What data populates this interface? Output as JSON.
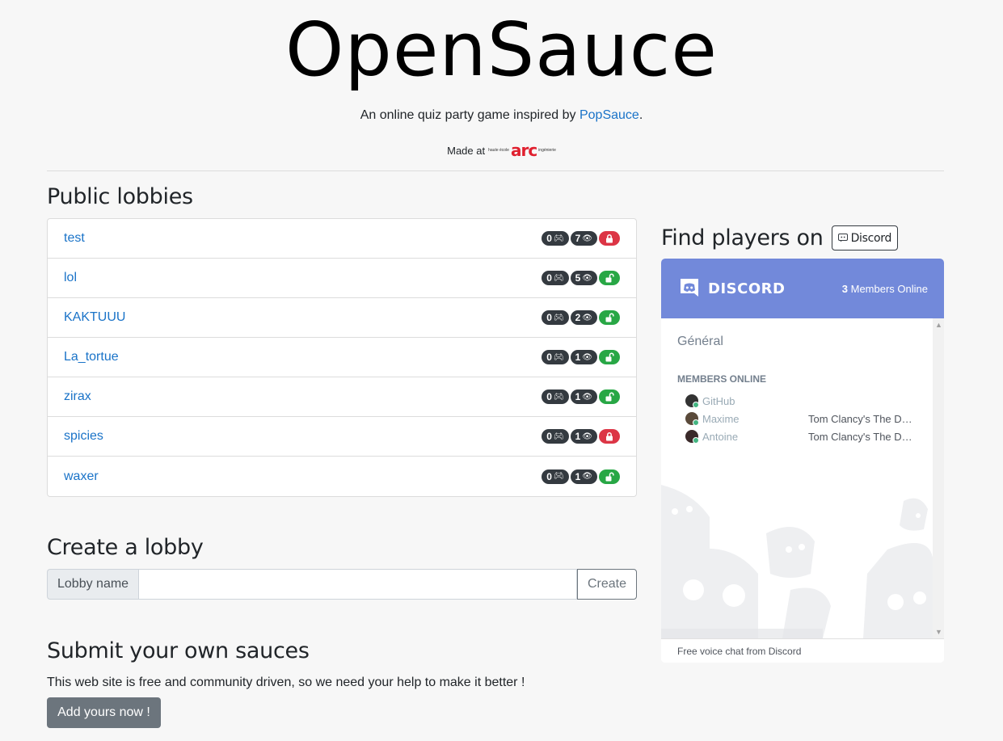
{
  "header": {
    "title": "OpenSauce",
    "subtitle_prefix": "An online quiz party game inspired by ",
    "subtitle_link": "PopSauce",
    "subtitle_suffix": ".",
    "made_at": "Made at",
    "school_small_1": "haute école",
    "school_arc": "arc",
    "school_small_2": "ingénierie"
  },
  "public_lobbies": {
    "title": "Public lobbies",
    "items": [
      {
        "name": "test",
        "players": "0",
        "spectators": "7",
        "locked": true
      },
      {
        "name": "lol",
        "players": "0",
        "spectators": "5",
        "locked": false
      },
      {
        "name": "KAKTUUU",
        "players": "0",
        "spectators": "2",
        "locked": false
      },
      {
        "name": "La_tortue",
        "players": "0",
        "spectators": "1",
        "locked": false
      },
      {
        "name": "zirax",
        "players": "0",
        "spectators": "1",
        "locked": false
      },
      {
        "name": "spicies",
        "players": "0",
        "spectators": "1",
        "locked": true
      },
      {
        "name": "waxer",
        "players": "0",
        "spectators": "1",
        "locked": false
      }
    ]
  },
  "create_lobby": {
    "title": "Create a lobby",
    "addon_label": "Lobby name",
    "input_value": "",
    "button_label": "Create"
  },
  "submit": {
    "title": "Submit your own sauces",
    "text": "This web site is free and community driven, so we need your help to make it better !",
    "button_label": "Add yours now !"
  },
  "discord": {
    "find_title": "Find players on",
    "pill_label": "Discord",
    "brand": "DISCORD",
    "online_count": "3",
    "online_label": " Members Online",
    "channel": "Général",
    "members_head": "MEMBERS ONLINE",
    "members": [
      {
        "name": "GitHub",
        "game": ""
      },
      {
        "name": "Maxime",
        "game": "Tom Clancy's The Division"
      },
      {
        "name": "Antoine",
        "game": "Tom Clancy's The Division"
      }
    ],
    "footer": "Free voice chat from Discord",
    "accent": "#7289da"
  }
}
